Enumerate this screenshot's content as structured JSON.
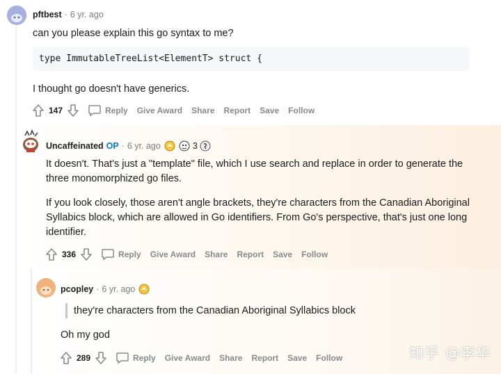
{
  "comments": [
    {
      "username": "pftbest",
      "separator": "·",
      "time": "6 yr. ago",
      "body": [
        "can you please explain this go syntax to me?",
        "I thought go doesn't have generics."
      ],
      "code": "type ImmutableTreeList<ElementT> struct {",
      "votes": "147",
      "avatar_color": "#9aa5d6"
    },
    {
      "username": "Uncaffeinated",
      "op_label": "OP",
      "separator": "·",
      "time": "6 yr. ago",
      "award_count": "3",
      "body": [
        "It doesn't. That's just a \"template\" file, which I use search and replace in order to generate the three monomorphized go files.",
        "If you look closely, those aren't angle brackets, they're characters from the Canadian Aboriginal Syllabics block, which are allowed in Go identifiers. From Go's perspective, that's just one long identifier."
      ],
      "votes": "336",
      "highlight_color": "#fdf6ec"
    },
    {
      "username": "pcopley",
      "separator": "·",
      "time": "6 yr. ago",
      "quote": "they're characters from the Canadian Aboriginal Syllabics block",
      "body": [
        "Oh my god"
      ],
      "votes": "289",
      "avatar_color": "#e8a36a"
    }
  ],
  "actions": {
    "reply": "Reply",
    "give_award": "Give Award",
    "share": "Share",
    "report": "Report",
    "save": "Save",
    "follow": "Follow"
  },
  "watermark": "知乎 @李华",
  "icons": [
    "upvote-icon",
    "downvote-icon",
    "comment-icon",
    "award-icon"
  ]
}
